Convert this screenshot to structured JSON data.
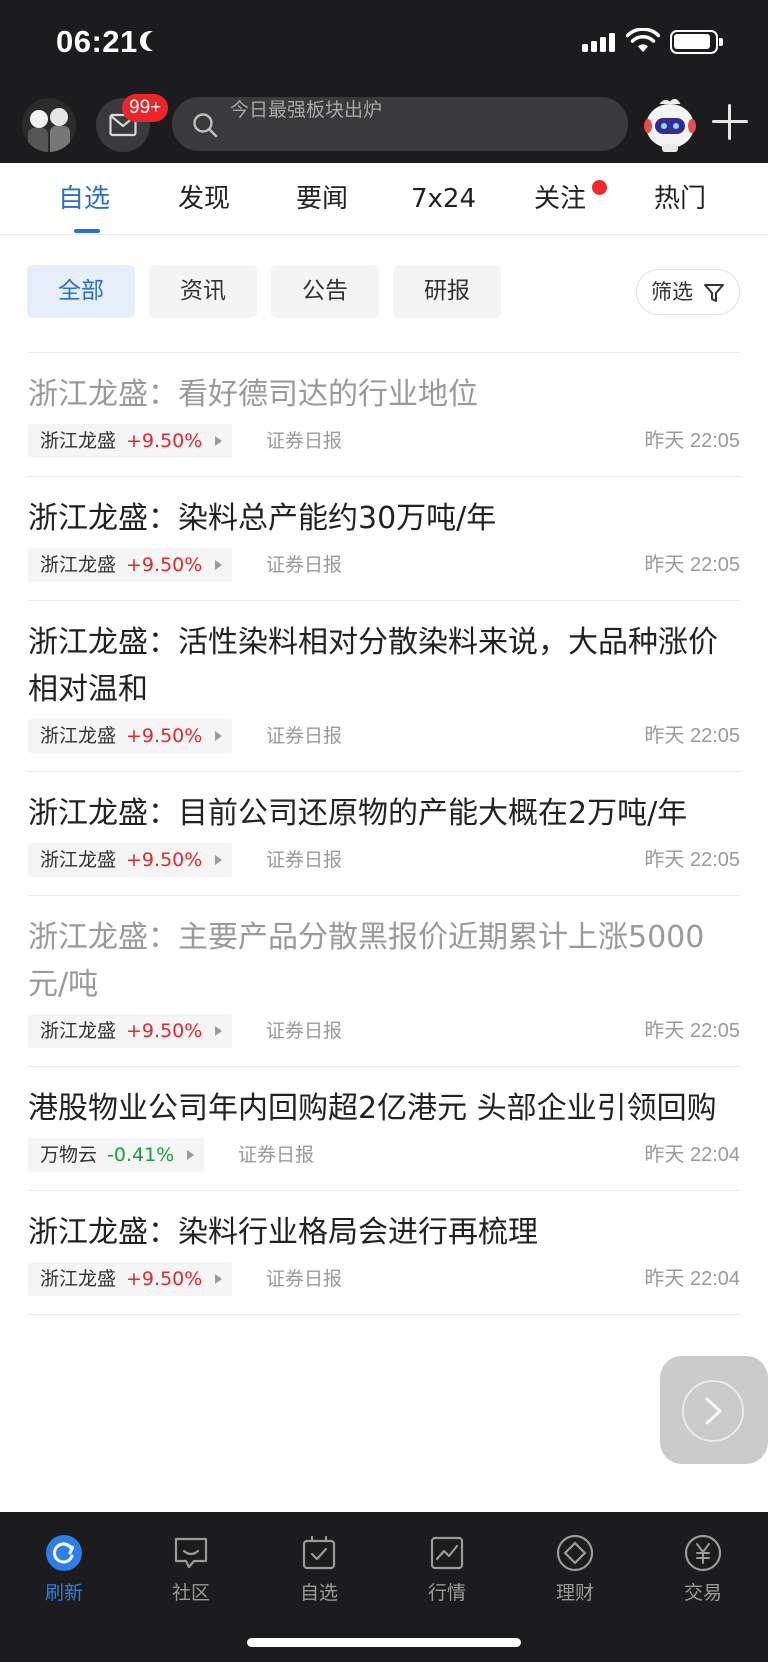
{
  "status_bar": {
    "time": "06:21"
  },
  "header": {
    "mail_badge": "99+",
    "search_placeholder": "今日最强板块出炉"
  },
  "tabs": [
    {
      "label": "自选",
      "active": true
    },
    {
      "label": "发现"
    },
    {
      "label": "要闻"
    },
    {
      "label": "7x24"
    },
    {
      "label": "关注",
      "dot": true
    },
    {
      "label": "热门"
    }
  ],
  "chips": [
    {
      "label": "全部",
      "active": true
    },
    {
      "label": "资讯"
    },
    {
      "label": "公告"
    },
    {
      "label": "研报"
    }
  ],
  "filter_label": "筛选",
  "feed": [
    {
      "title": "浙江龙盛：看好德司达的行业地位",
      "read": true,
      "stock": "浙江龙盛",
      "change": "+9.50%",
      "dir": "up",
      "source": "证券日报",
      "time": "昨天 22:05"
    },
    {
      "title": "浙江龙盛：染料总产能约30万吨/年",
      "stock": "浙江龙盛",
      "change": "+9.50%",
      "dir": "up",
      "source": "证券日报",
      "time": "昨天 22:05"
    },
    {
      "title": "浙江龙盛：活性染料相对分散染料来说，大品种涨价相对温和",
      "stock": "浙江龙盛",
      "change": "+9.50%",
      "dir": "up",
      "source": "证券日报",
      "time": "昨天 22:05"
    },
    {
      "title": "浙江龙盛：目前公司还原物的产能大概在2万吨/年",
      "stock": "浙江龙盛",
      "change": "+9.50%",
      "dir": "up",
      "source": "证券日报",
      "time": "昨天 22:05"
    },
    {
      "title": "浙江龙盛：主要产品分散黑报价近期累计上涨5000元/吨",
      "read": true,
      "stock": "浙江龙盛",
      "change": "+9.50%",
      "dir": "up",
      "source": "证券日报",
      "time": "昨天 22:05"
    },
    {
      "title": "港股物业公司年内回购超2亿港元 头部企业引领回购",
      "stock": "万物云",
      "change": "-0.41%",
      "dir": "down",
      "source": "证券日报",
      "time": "昨天 22:04"
    },
    {
      "title": "浙江龙盛：染料行业格局会进行再梳理",
      "stock": "浙江龙盛",
      "change": "+9.50%",
      "dir": "up",
      "source": "证券日报",
      "time": "昨天 22:04"
    }
  ],
  "bottom_tabs": [
    {
      "label": "刷新",
      "icon": "refresh-icon",
      "active": true
    },
    {
      "label": "社区",
      "icon": "community-icon"
    },
    {
      "label": "自选",
      "icon": "watchlist-icon"
    },
    {
      "label": "行情",
      "icon": "market-icon"
    },
    {
      "label": "理财",
      "icon": "wealth-icon"
    },
    {
      "label": "交易",
      "icon": "trade-icon"
    }
  ],
  "colors": {
    "accent": "#2b6fd1",
    "up": "#e8262b",
    "down": "#1a9e3c",
    "dark_bar": "#1c1c1e"
  }
}
